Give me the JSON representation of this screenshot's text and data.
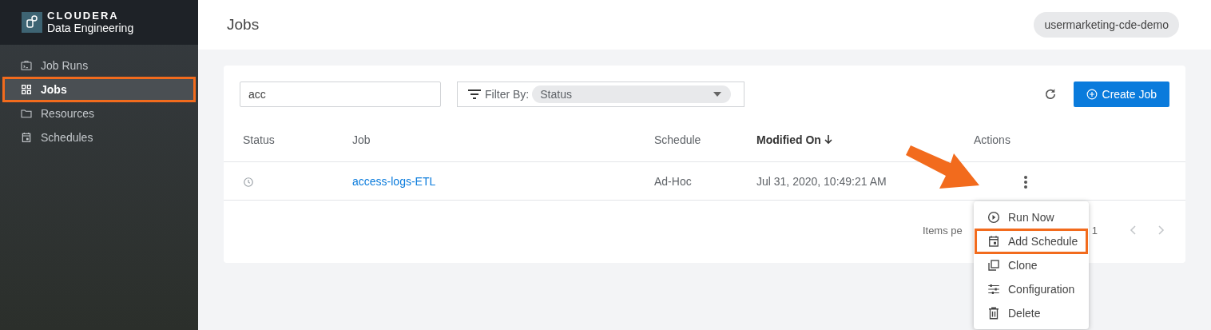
{
  "brand": {
    "company": "CLOUDERA",
    "product": "Data Engineering"
  },
  "sidebar": {
    "items": [
      {
        "label": "Job Runs",
        "kind": "terminal",
        "selected": false,
        "highlighted": false
      },
      {
        "label": "Jobs",
        "kind": "grid",
        "selected": true,
        "highlighted": true
      },
      {
        "label": "Resources",
        "kind": "folder",
        "selected": false,
        "highlighted": false
      },
      {
        "label": "Schedules",
        "kind": "calendar",
        "selected": false,
        "highlighted": false
      }
    ]
  },
  "header": {
    "title": "Jobs",
    "environment": "usermarketing-cde-demo"
  },
  "toolbar": {
    "search": {
      "value": "acc"
    },
    "filter": {
      "label": "Filter By:",
      "value": "Status"
    },
    "create_button": "Create Job"
  },
  "table": {
    "columns": [
      {
        "label": "Status",
        "sorted": false
      },
      {
        "label": "Job",
        "sorted": false
      },
      {
        "label": "Schedule",
        "sorted": false
      },
      {
        "label": "Modified On",
        "sorted": true
      },
      {
        "label": "Actions",
        "sorted": false
      }
    ],
    "rows": [
      {
        "job": "access-logs-ETL",
        "schedule": "Ad-Hoc",
        "modified": "Jul 31, 2020, 10:49:21 AM"
      }
    ]
  },
  "pagination": {
    "label": "Items pe",
    "range": "1"
  },
  "action_menu": {
    "items": [
      {
        "label": "Run Now",
        "kind": "play",
        "highlighted": false
      },
      {
        "label": "Add Schedule",
        "kind": "calendar",
        "highlighted": true
      },
      {
        "label": "Clone",
        "kind": "clone",
        "highlighted": false
      },
      {
        "label": "Configuration",
        "kind": "sliders",
        "highlighted": false
      },
      {
        "label": "Delete",
        "kind": "trash",
        "highlighted": false
      }
    ]
  }
}
